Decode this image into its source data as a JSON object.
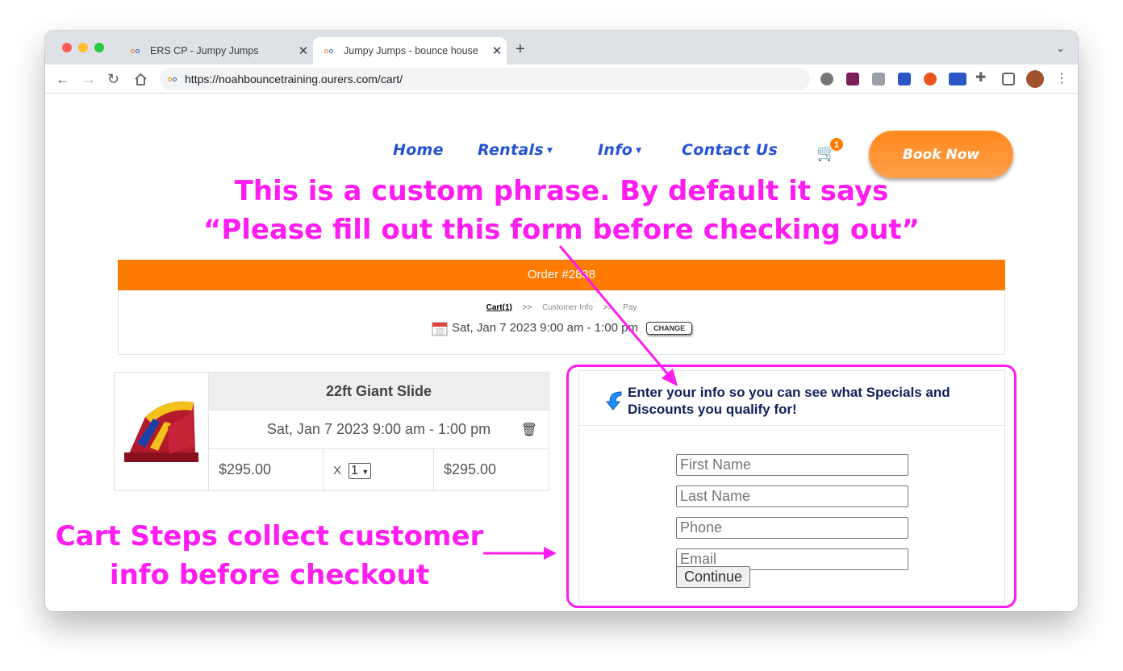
{
  "browser": {
    "tabs": [
      {
        "title": "ERS CP - Jumpy Jumps"
      },
      {
        "title": "Jumpy Jumps - bounce house"
      }
    ],
    "url": "https://noahbouncetraining.ourers.com/cart/"
  },
  "site": {
    "nav": {
      "home": "Home",
      "rentals": "Rentals",
      "info": "Info",
      "contact": "Contact Us",
      "cart_count": "1",
      "book_now": "Book Now"
    }
  },
  "annotations": {
    "top_line1": "This is a custom phrase. By default it says",
    "top_line2": "“Please fill out this form before checking out”",
    "left_line1": "Cart Steps collect customer",
    "left_line2": "info before checkout"
  },
  "order": {
    "title": "Order #2838",
    "steps": {
      "cart": "Cart(1)",
      "sep": ">>",
      "customer_info": "Customer Info",
      "pay": "Pay"
    },
    "date": "Sat, Jan 7 2023 9:00 am - 1:00 pm",
    "change_label": "CHANGE"
  },
  "cart": {
    "item_name": "22ft Giant Slide",
    "item_date": "Sat, Jan 7 2023 9:00 am - 1:00 pm",
    "price": "$295.00",
    "qty_prefix": "X",
    "qty": "1",
    "total": "$295.00"
  },
  "customer": {
    "heading_line1": "Enter your info so you can see what Specials and",
    "heading_line2": "Discounts you qualify for!",
    "first_name_placeholder": "First Name",
    "last_name_placeholder": "Last Name",
    "phone_placeholder": "Phone",
    "email_placeholder": "Email",
    "continue_label": "Continue"
  },
  "colors": {
    "accent_orange": "#ff7b00",
    "nav_blue": "#2452d6",
    "annotation_magenta": "#ff1cf0"
  }
}
